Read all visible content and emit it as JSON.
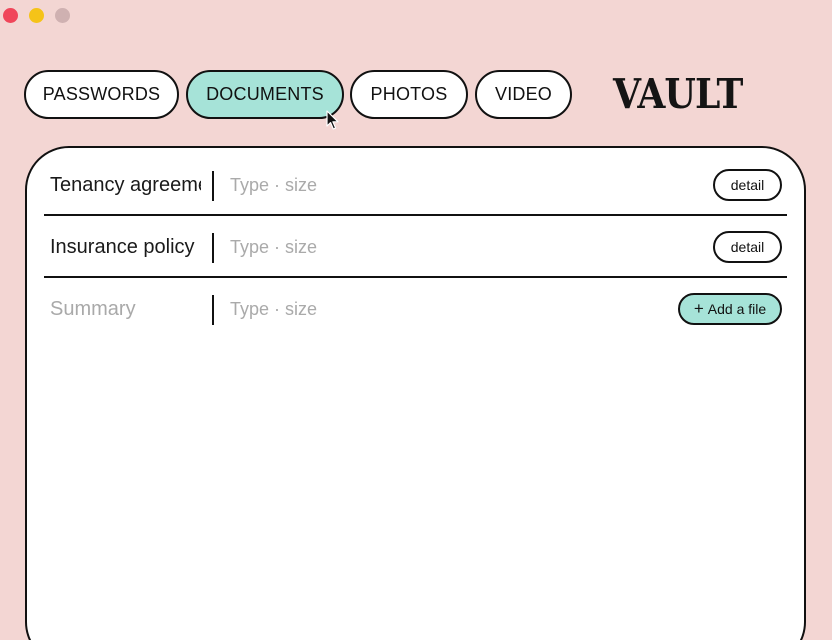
{
  "window": {
    "controls": [
      "close",
      "minimize",
      "maximize"
    ]
  },
  "tabs": [
    {
      "label": "PASSWORDS",
      "active": false
    },
    {
      "label": "DOCUMENTS",
      "active": true
    },
    {
      "label": "PHOTOS",
      "active": false
    },
    {
      "label": "VIDEO",
      "active": false
    }
  ],
  "brand": {
    "title": "VAULT"
  },
  "documents": {
    "rows": [
      {
        "name": "Tenancy agreement",
        "meta": "Type · size",
        "action": "detail"
      },
      {
        "name": "Insurance policy",
        "meta": "Type · size",
        "action": "detail"
      }
    ],
    "new_row": {
      "name_placeholder": "Summary",
      "meta_placeholder": "Type · size",
      "add_icon": "plus-icon",
      "add_label": "Add a file"
    }
  },
  "colors": {
    "background": "#f3d6d3",
    "accent": "#a6e3d8",
    "close": "#f0465a",
    "minimize": "#f5c318",
    "maximize": "#cfb1b1"
  }
}
